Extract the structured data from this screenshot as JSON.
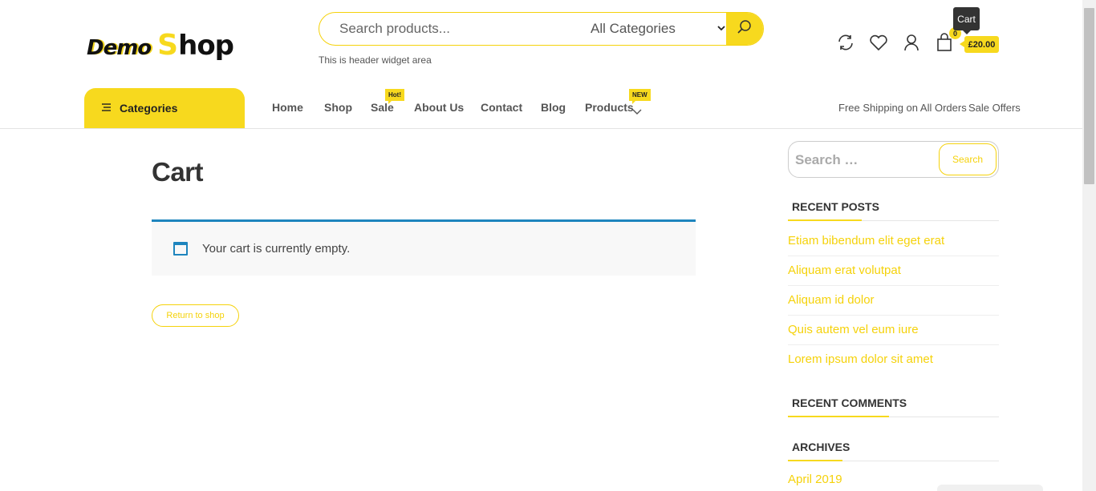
{
  "header": {
    "logo_word1": "Demo",
    "logo_s": "S",
    "logo_rest": "hop",
    "search_placeholder": "Search products...",
    "category_select": "All Categories",
    "widget_text": "This is header widget area",
    "cart_tooltip": "Cart",
    "cart_count": "0",
    "cart_total": "£20.00"
  },
  "nav": {
    "categories_label": "Categories",
    "items": [
      {
        "label": "Home"
      },
      {
        "label": "Shop"
      },
      {
        "label": "Sale",
        "badge": "Hot!"
      },
      {
        "label": "About Us"
      },
      {
        "label": "Contact"
      },
      {
        "label": "Blog"
      },
      {
        "label": "Products",
        "badge": "NEW"
      }
    ],
    "right": [
      "Free Shipping on All Orders",
      "Sale Offers"
    ]
  },
  "main": {
    "title": "Cart",
    "notice": "Your cart is currently empty.",
    "return_label": "Return to shop"
  },
  "sidebar": {
    "search_placeholder": "Search …",
    "search_button": "Search",
    "recent_posts_title": "RECENT POSTS",
    "recent_posts": [
      "Etiam bibendum elit eget erat",
      "Aliquam erat volutpat",
      "Aliquam id dolor",
      "Quis autem vel eum iure",
      "Lorem ipsum dolor sit amet"
    ],
    "recent_comments_title": "RECENT COMMENTS",
    "archives_title": "ARCHIVES",
    "archives": [
      "April 2019"
    ]
  },
  "colors": {
    "accent": "#f7d91e",
    "notice_border": "#1e85be",
    "text": "#333333"
  },
  "icons": [
    "search-icon",
    "compare-icon",
    "heart-icon",
    "user-icon",
    "cart-icon",
    "menu-lines-icon",
    "chevron-down-icon",
    "window-icon"
  ]
}
